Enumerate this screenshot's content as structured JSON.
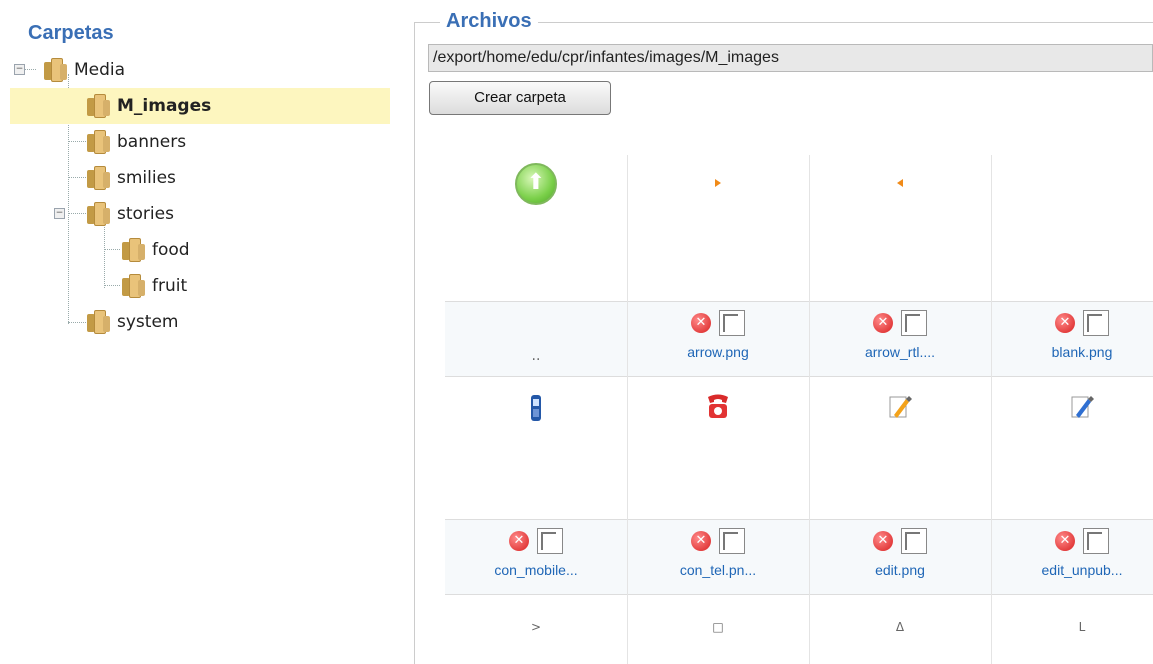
{
  "folders_panel": {
    "title": "Carpetas",
    "tree": [
      {
        "label": "Media"
      },
      {
        "label": "M_images"
      },
      {
        "label": "banners"
      },
      {
        "label": "smilies"
      },
      {
        "label": "stories"
      },
      {
        "label": "food"
      },
      {
        "label": "fruit"
      },
      {
        "label": "system"
      }
    ]
  },
  "files_panel": {
    "title": "Archivos",
    "path": "/export/home/edu/cpr/infantes/images/M_images",
    "create_folder_button": "Crear carpeta",
    "parent_label": "..",
    "files": [
      {
        "name": "arrow.png",
        "icon": "orange-right-triangle-icon"
      },
      {
        "name": "arrow_rtl....",
        "icon": "orange-left-triangle-icon"
      },
      {
        "name": "blank.png",
        "icon": "blank-icon"
      },
      {
        "name": "con_mobile...",
        "icon": "mobile-phone-icon"
      },
      {
        "name": "con_tel.pn...",
        "icon": "red-telephone-icon"
      },
      {
        "name": "edit.png",
        "icon": "edit-pencil-icon"
      },
      {
        "name": "edit_unpub...",
        "icon": "edit-unpublished-icon"
      }
    ],
    "partial_row_glyphs": [
      ">",
      "□",
      "Δ",
      "L"
    ]
  },
  "colors": {
    "title_blue": "#3a6fb5",
    "link_blue": "#1f66b6",
    "selected_bg": "#fdf6bf"
  }
}
